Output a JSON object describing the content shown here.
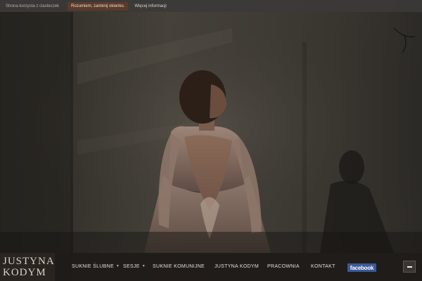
{
  "cookie_bar": {
    "text": "Strona korzysta z ciasteczek",
    "accept_label": "Rozumiem, zamknij okienko.",
    "more_label": "Więcej informacji"
  },
  "logo": {
    "line1": "JUSTYNA",
    "line2": "KODYM"
  },
  "nav": {
    "items": [
      {
        "label": "SUKNIE ŚLUBNE",
        "has_submenu": true
      },
      {
        "label": "SESJE",
        "has_submenu": true
      },
      {
        "label": "SUKNIE KOMUNIJNE",
        "has_submenu": false
      },
      {
        "label": "JUSTYNA KODYM",
        "has_submenu": false
      },
      {
        "label": "PRACOWNIA",
        "has_submenu": false
      },
      {
        "label": "KONTAKT",
        "has_submenu": false
      }
    ],
    "caret": "▼",
    "facebook_label": "facebook",
    "collapse_icon": "minus-icon"
  },
  "colors": {
    "nav_bg": "#201c1a",
    "cookie_accept_bg": "#5a3a2a",
    "facebook": "#3b5998"
  }
}
